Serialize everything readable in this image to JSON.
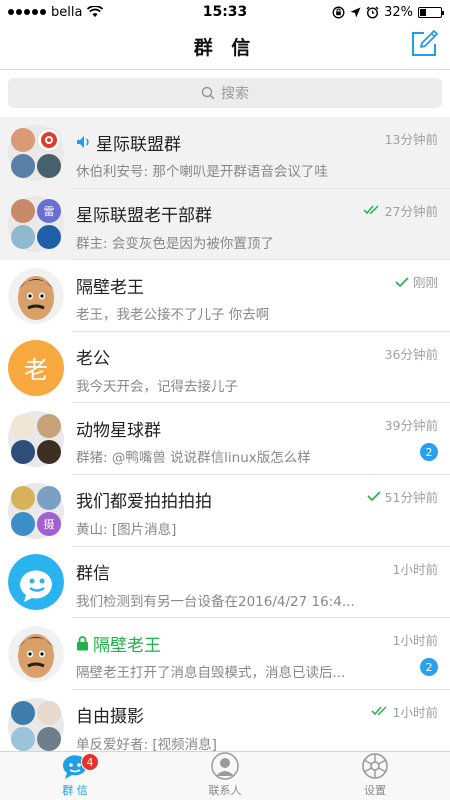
{
  "status": {
    "carrier": "bella",
    "time": "15:33",
    "battery": "32%",
    "battery_level": 0.32
  },
  "nav": {
    "title": "群 信"
  },
  "search": {
    "placeholder": "搜索"
  },
  "conversations": [
    {
      "title": "星际联盟群",
      "preview": "休伯利安号: 那个喇叭是开群语音会议了哇",
      "time": "13分钟前",
      "pinned": true
    },
    {
      "title": "星际联盟老干部群",
      "preview": "群主: 会变灰色是因为被你置顶了",
      "time": "27分钟前",
      "pinned": true,
      "avatar_text": "雷"
    },
    {
      "title": "隔壁老王",
      "preview": "老王，我老公接不了儿子 你去啊",
      "time": "刚刚"
    },
    {
      "title": "老公",
      "preview": "我今天开会，记得去接儿子",
      "time": "36分钟前",
      "avatar_text": "老"
    },
    {
      "title": "动物星球群",
      "preview": "群猪: @鸭嘴兽 说说群信linux版怎么样",
      "time": "39分钟前",
      "badge": "2"
    },
    {
      "title": "我们都爱拍拍拍拍",
      "preview": "黄山: [图片消息]",
      "time": "51分钟前",
      "avatar_text": "摄"
    },
    {
      "title": "群信",
      "preview": "我们检测到有另一台设备在2016/4/27 16:4...",
      "time": "1小时前"
    },
    {
      "title": "隔壁老王",
      "preview": "隔壁老王打开了消息自毁模式，消息已读后...",
      "time": "1小时前",
      "badge": "2"
    },
    {
      "title": "自由摄影",
      "preview": "单反爱好者: [视频消息]",
      "time": "1小时前"
    }
  ],
  "tabs": [
    {
      "label": "群 信",
      "badge": "4"
    },
    {
      "label": "联系人"
    },
    {
      "label": "设置"
    }
  ],
  "colors": {
    "accent": "#1e9fe6",
    "badge_blue": "#29a1f0",
    "badge_red": "#e8302a",
    "read_check": "#21b24b",
    "pinned_bg": "#f2f2f2"
  }
}
